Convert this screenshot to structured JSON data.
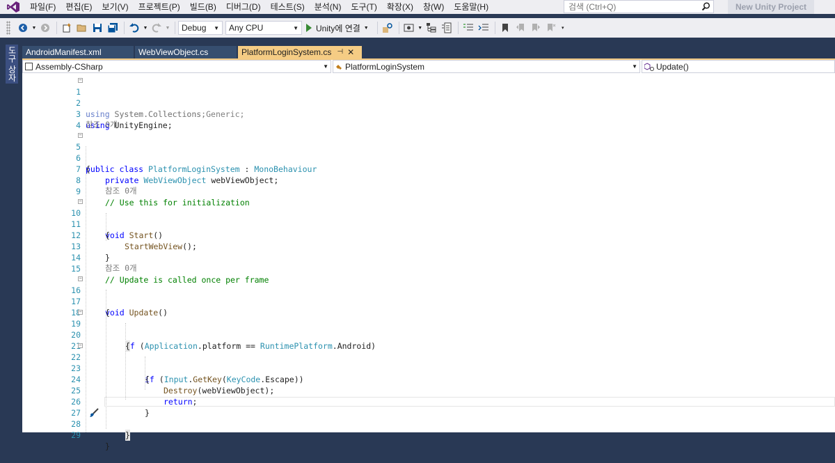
{
  "menu": {
    "items": [
      "파일(F)",
      "편집(E)",
      "보기(V)",
      "프로젝트(P)",
      "빌드(B)",
      "디버그(D)",
      "테스트(S)",
      "분석(N)",
      "도구(T)",
      "확장(X)",
      "창(W)",
      "도움말(H)"
    ],
    "search_placeholder": "검색 (Ctrl+Q)",
    "project_name": "New Unity Project"
  },
  "toolbar": {
    "config": "Debug",
    "platform": "Any CPU",
    "run_label": "Unity에 연결"
  },
  "side_panel": {
    "label": "도구 상자"
  },
  "tabs": [
    {
      "label": "AndroidManifest.xml",
      "active": false
    },
    {
      "label": "WebViewObject.cs",
      "active": false
    },
    {
      "label": "PlatformLoginSystem.cs",
      "active": true
    }
  ],
  "tab_pin": "⊣",
  "tab_close": "✕",
  "navbar": {
    "project": "Assembly-CSharp",
    "class": "PlatformLoginSystem",
    "member": "Update()"
  },
  "references": {
    "class_ref": "참조 0개",
    "start_ref": "참조 0개",
    "update_ref": "참조 0개"
  },
  "colors": {
    "accent_tab": "#f5cc84",
    "ide_background": "#293955",
    "keyword": "#0000ff",
    "type": "#2b91af",
    "comment": "#008000"
  },
  "code": {
    "l1": [
      "using",
      " System.Collections;"
    ],
    "l2": [
      "using",
      " System.Collections.Generic;"
    ],
    "l3": [
      "using",
      " UnityEngine;"
    ],
    "l5": [
      "public",
      " class ",
      "PlatformLoginSystem",
      " : ",
      "MonoBehaviour"
    ],
    "l6": "{",
    "l7": [
      "private ",
      "WebViewObject",
      " webViewObject;"
    ],
    "l9": "// Use this for initialization",
    "l10": [
      "void ",
      "Start",
      "()"
    ],
    "l11": "{",
    "l12": [
      "StartWebView",
      "();"
    ],
    "l13": "}",
    "l15": "// Update is called once per frame",
    "l16": [
      "void ",
      "Update",
      "()"
    ],
    "l17": "{",
    "l19": [
      "if",
      " (",
      "Application",
      ".platform == ",
      "RuntimePlatform",
      ".Android)"
    ],
    "l20": "{",
    "l22": [
      "if",
      " (",
      "Input",
      ".",
      "GetKey",
      "(",
      "KeyCode",
      ".Escape))"
    ],
    "l23": "{",
    "l24": [
      "Destroy",
      "(webViewObject);"
    ],
    "l25": [
      "return",
      ";"
    ],
    "l26": "}",
    "l27": "}",
    "l29": "}"
  },
  "line_numbers": [
    "1",
    "2",
    "3",
    "4",
    "5",
    "6",
    "7",
    "8",
    "9",
    "10",
    "11",
    "12",
    "13",
    "14",
    "15",
    "16",
    "17",
    "18",
    "19",
    "20",
    "21",
    "22",
    "23",
    "24",
    "25",
    "26",
    "27",
    "28",
    "29"
  ]
}
